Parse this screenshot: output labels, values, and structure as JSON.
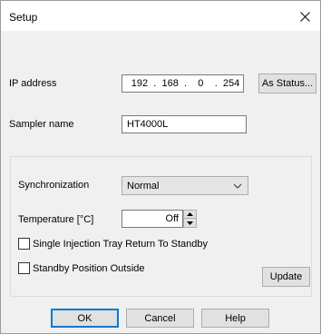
{
  "window": {
    "title": "Setup"
  },
  "ip": {
    "label": "IP address",
    "octets": [
      "192",
      "168",
      "0",
      "254"
    ],
    "separator": ".",
    "as_status_label": "As Status..."
  },
  "sampler": {
    "label": "Sampler name",
    "value": "HT4000L"
  },
  "sync": {
    "label": "Synchronization",
    "value": "Normal"
  },
  "temperature": {
    "label": "Temperature [°C]",
    "value": "Off"
  },
  "checkboxes": {
    "single_injection": {
      "label": "Single Injection Tray Return To Standby",
      "checked": false
    },
    "standby_outside": {
      "label": "Standby Position Outside",
      "checked": false
    }
  },
  "buttons": {
    "update": "Update",
    "ok": "OK",
    "cancel": "Cancel",
    "help": "Help"
  },
  "colors": {
    "focus": "#0078d7",
    "window_bg": "#f0f0f0",
    "titlebar_bg": "#ffffff"
  },
  "icons": {
    "close": "close-icon",
    "combo_arrow": "chevron-down-icon",
    "spin_up": "spin-up-icon",
    "spin_down": "spin-down-icon"
  }
}
